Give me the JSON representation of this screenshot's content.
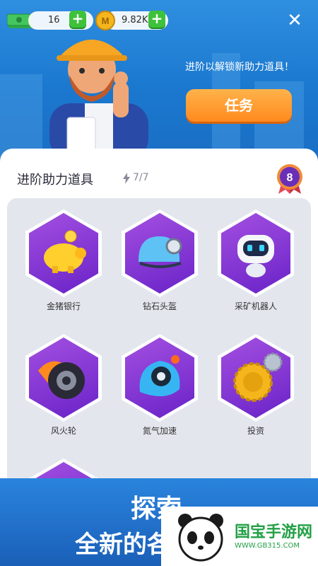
{
  "header": {
    "cash_value": "16",
    "coin_symbol": "M",
    "coin_value": "9.82K",
    "plus_label": "+",
    "close_label": "✕",
    "unlock_text": "进阶以解锁新助力道具！",
    "task_button": "任务"
  },
  "panel": {
    "title": "进阶助力道具",
    "count": "7/7",
    "level": "8"
  },
  "items": [
    {
      "label": "金猪银行",
      "icon": "piggy-bank-icon"
    },
    {
      "label": "钻石头盔",
      "icon": "helmet-icon"
    },
    {
      "label": "采矿机器人",
      "icon": "robot-icon"
    },
    {
      "label": "风火轮",
      "icon": "wheel-icon"
    },
    {
      "label": "氮气加速",
      "icon": "nitro-icon"
    },
    {
      "label": "投资",
      "icon": "gears-icon"
    }
  ],
  "banner": {
    "line1": "探索",
    "line2": "全新的各"
  },
  "watermark": {
    "name": "国宝手游网",
    "url": "WWW.GB315.COM"
  },
  "colors": {
    "accent_orange": "#ff8a1e",
    "plus_green": "#3ec23b",
    "hex_purple": "#8a36d6",
    "badge_purple": "#6a2fb8"
  }
}
